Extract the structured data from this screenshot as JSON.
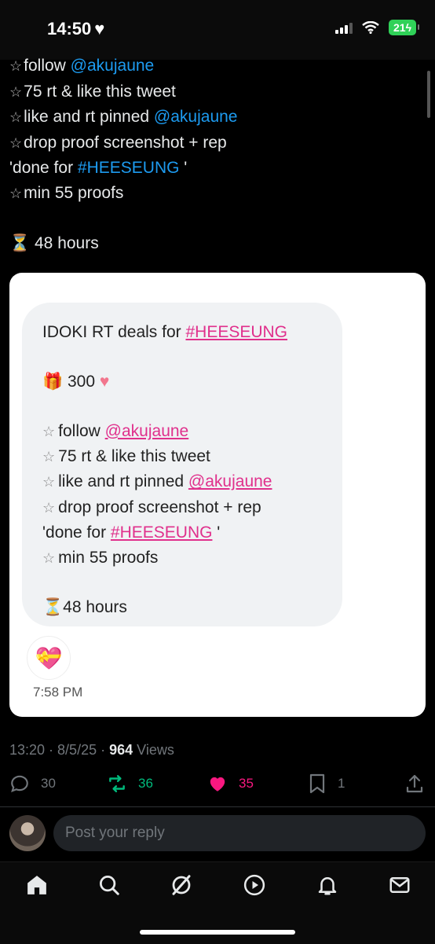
{
  "status_bar": {
    "time": "14:50",
    "battery": "21"
  },
  "tweet": {
    "lines": [
      {
        "star": "☆",
        "text": "follow ",
        "link": "@akujaune"
      },
      {
        "star": "☆",
        "text": "75 rt & like this tweet"
      },
      {
        "star": "☆",
        "text": "like and rt pinned ",
        "link": "@akujaune"
      },
      {
        "star": "☆",
        "text": "drop proof screenshot + rep"
      },
      {
        "pre": "'done for ",
        "link": "#HEESEUNG",
        "post": " '"
      },
      {
        "star": "☆",
        "text": "min 55 proofs"
      }
    ],
    "duration": "48 hours"
  },
  "card": {
    "title_prefix": "IDOKI RT deals for ",
    "title_tag": "#HEESEUNG",
    "prize_count": "300",
    "lines": {
      "l1_text": "follow ",
      "l1_link": "@akujaune",
      "l2_text": "75 rt & like this tweet",
      "l3_text": "like and rt pinned ",
      "l3_link": "@akujaune",
      "l4_text": "drop proof screenshot + rep",
      "l5_pre": "'done for ",
      "l5_link": "#HEESEUNG",
      "l5_post": "'",
      "l6_text": "min 55 proofs"
    },
    "duration": "48 hours",
    "timestamp": "7:58 PM"
  },
  "meta": {
    "time_date": "13:20 · 8/5/25 · ",
    "views_count": "964",
    "views_label": " Views"
  },
  "actions": {
    "replies": "30",
    "retweets": "36",
    "likes": "35",
    "bookmarks": "1"
  },
  "reply": {
    "placeholder": "Post your reply"
  },
  "colors": {
    "link": "#1d9bf0",
    "retweet": "#00ba7c",
    "like": "#f91880",
    "card_link": "#e0308c"
  },
  "nav": [
    "home-icon",
    "search-icon",
    "grok-icon",
    "video-icon",
    "notifications-icon",
    "messages-icon"
  ]
}
